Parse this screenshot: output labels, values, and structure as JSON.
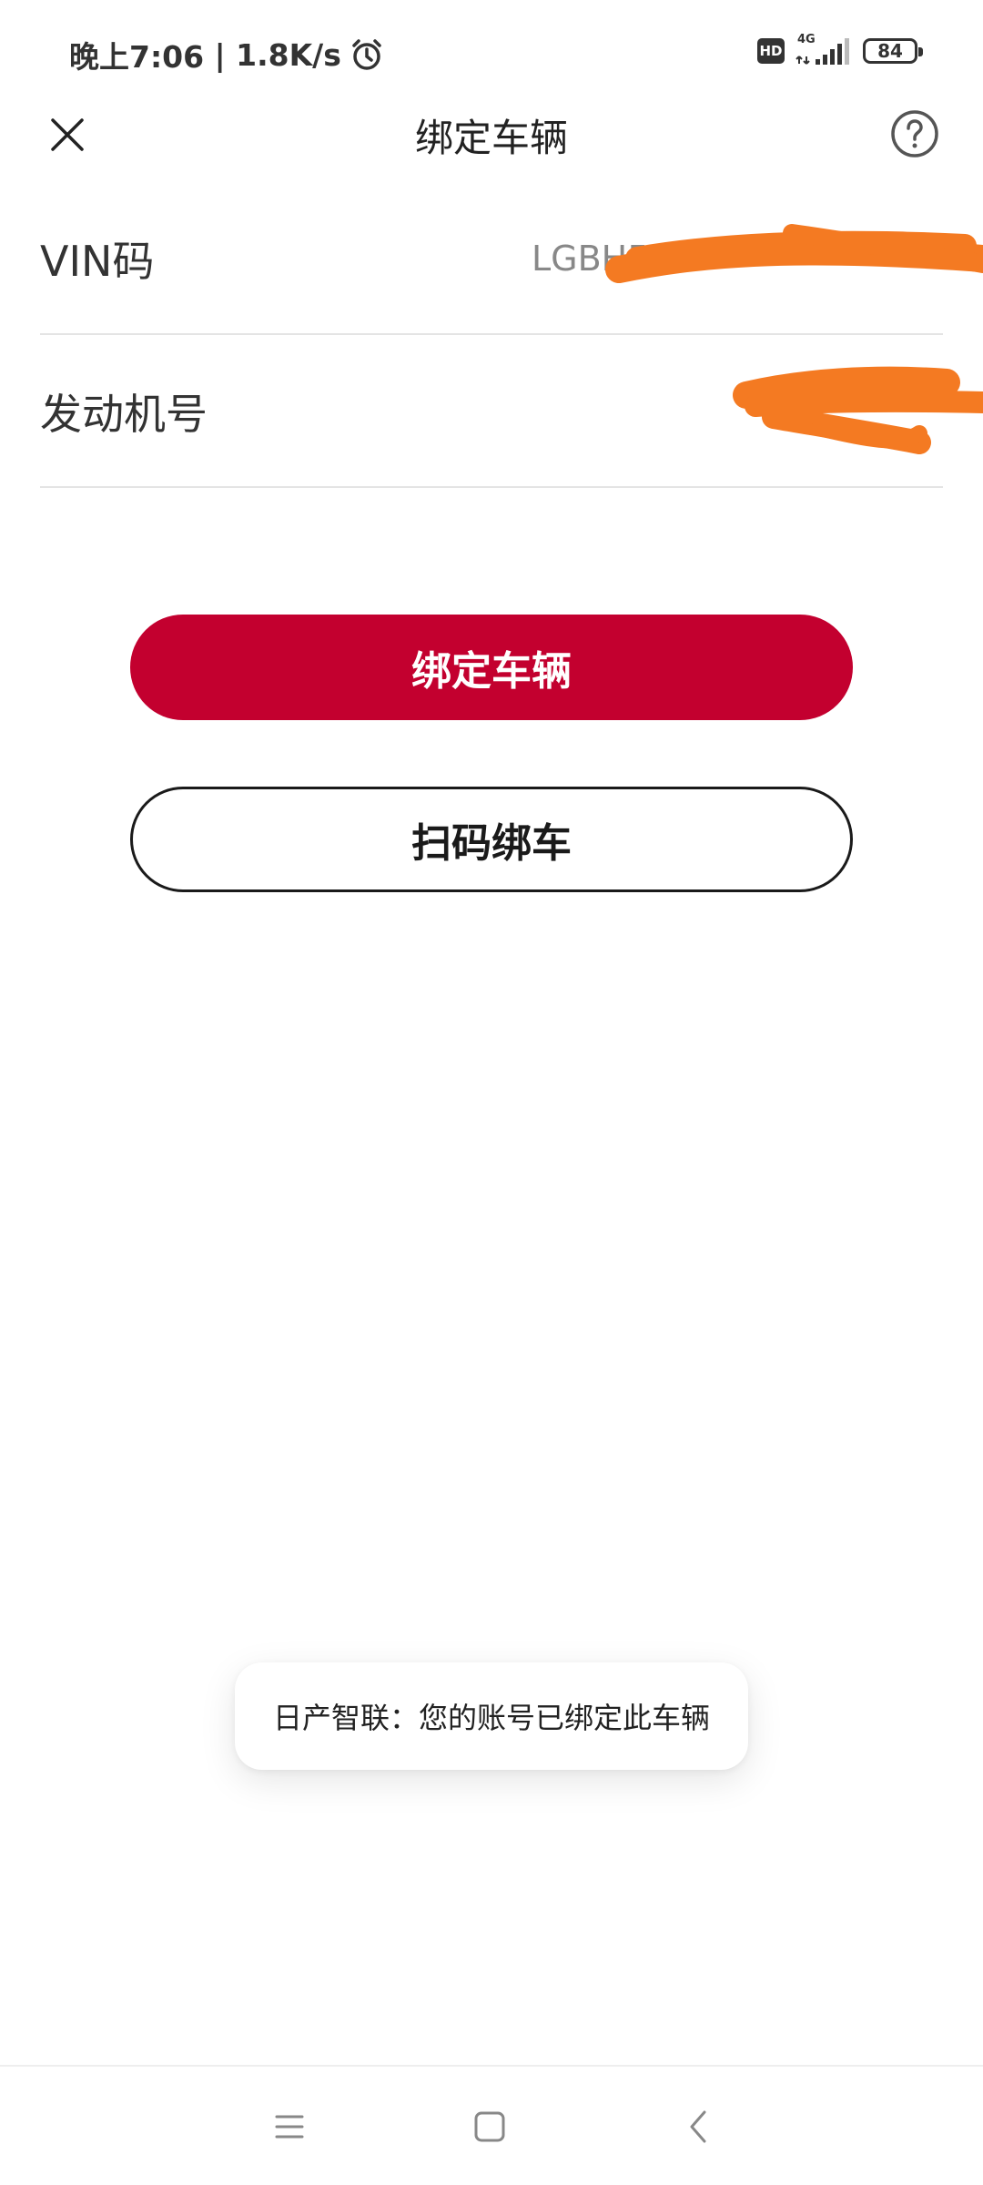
{
  "status_bar": {
    "time": "晚上7:06",
    "speed": "1.8K/s",
    "hd": "HD",
    "network": "4G",
    "battery": "84"
  },
  "header": {
    "title": "绑定车辆",
    "close_icon": "close-icon",
    "help_icon": "help-circle-icon"
  },
  "form": {
    "vin_label": "VIN码",
    "vin_value": "LGBH5",
    "engine_label": "发动机号",
    "engine_value": ""
  },
  "buttons": {
    "bind_label": "绑定车辆",
    "scan_label": "扫码绑车"
  },
  "toast": {
    "message": "日产智联：您的账号已绑定此车辆"
  },
  "nav": {
    "menu_icon": "menu-icon",
    "home_icon": "home-square-icon",
    "back_icon": "back-chevron-icon"
  },
  "colors": {
    "accent": "#c3002f",
    "redaction": "#f47a22"
  }
}
